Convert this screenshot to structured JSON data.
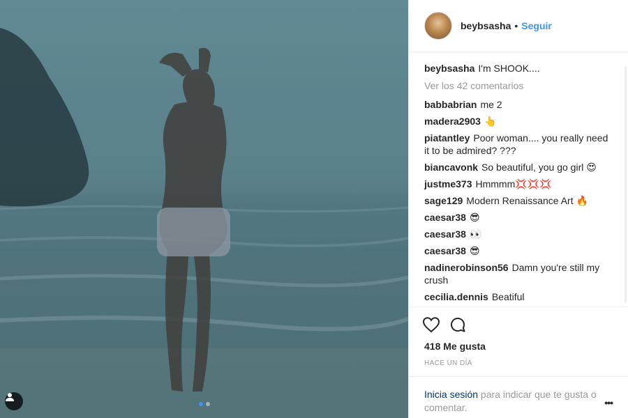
{
  "media": {
    "tag_icon": "person-tag-icon",
    "carousel": {
      "count": 2,
      "active": 0
    }
  },
  "header": {
    "username": "beybsasha",
    "separator": "•",
    "follow_label": "Seguir"
  },
  "caption": {
    "username": "beybsasha",
    "text": "I'm SHOOK...."
  },
  "view_all_comments": "Ver los 42 comentarios",
  "comments": [
    {
      "username": "babbabrian",
      "text": "me 2"
    },
    {
      "username": "madera2903",
      "text": "👆"
    },
    {
      "username": "piatantley",
      "text": "Poor woman.... you really need it to be admired? ???"
    },
    {
      "username": "biancavonk",
      "text": "So beautiful, you go girl 😍"
    },
    {
      "username": "justme373",
      "text": "Hmmmm💢💢💢"
    },
    {
      "username": "sage129",
      "text": "Modern Renaissance Art 🔥"
    },
    {
      "username": "caesar38",
      "text": "😎"
    },
    {
      "username": "caesar38",
      "text": "👀"
    },
    {
      "username": "caesar38",
      "text": "😎"
    },
    {
      "username": "nadinerobinson56",
      "text": "Damn you're still my crush"
    },
    {
      "username": "cecilia.dennis",
      "text": "Beatiful"
    }
  ],
  "actions": {
    "like_icon": "heart-icon",
    "comment_icon": "comment-icon"
  },
  "likes": "418 Me gusta",
  "timestamp": "HACE UN DÍA",
  "login": {
    "link": "Inicia sesión",
    "rest": " para indicar que te gusta o comentar.",
    "more_label": "•••"
  },
  "colors": {
    "accent": "#3897f0",
    "link_dark": "#003569",
    "muted": "#999999",
    "text": "#262626"
  }
}
